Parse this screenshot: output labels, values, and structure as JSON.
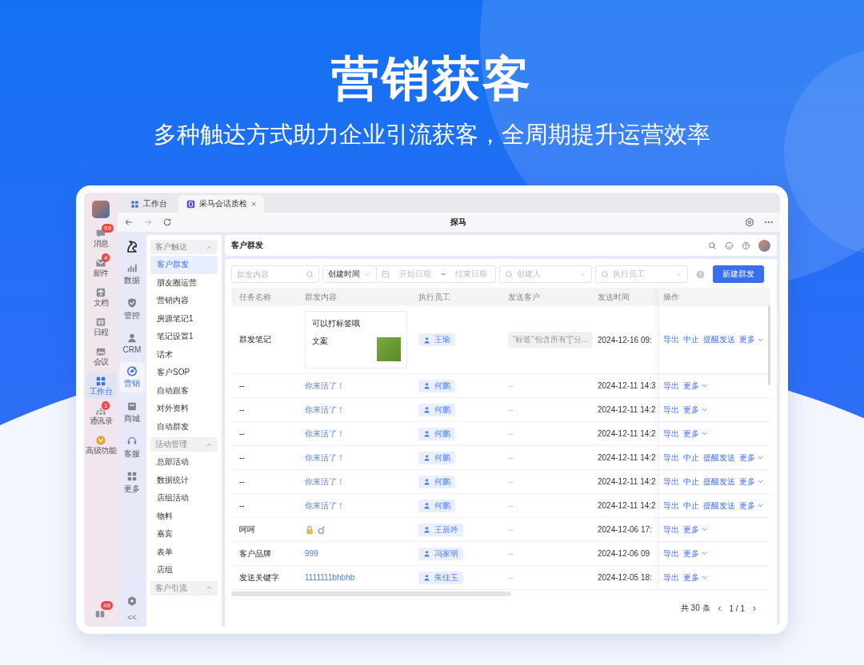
{
  "hero": {
    "title": "营销获客",
    "subtitle": "多种触达方式助力企业引流获客，全周期提升运营效率"
  },
  "app_rail": {
    "items": [
      {
        "label": "消息",
        "badge": "99",
        "selected": false
      },
      {
        "label": "邮件",
        "badge": "4",
        "selected": false
      },
      {
        "label": "文档",
        "selected": false
      },
      {
        "label": "日程",
        "selected": false
      },
      {
        "label": "会议",
        "selected": false
      },
      {
        "label": "工作台",
        "selected": true
      },
      {
        "label": "通讯录",
        "badge": "1",
        "selected": false
      },
      {
        "label": "高级功能",
        "selected": false
      }
    ],
    "footer_badge": "49"
  },
  "browser": {
    "tabs": [
      {
        "label": "工作台",
        "selected": false
      },
      {
        "label": "采马会话质检",
        "selected": true,
        "close": "×"
      }
    ],
    "title": "探马"
  },
  "module_rail": {
    "items": [
      {
        "label": "数据",
        "selected": false
      },
      {
        "label": "管控",
        "selected": false
      },
      {
        "label": "CRM",
        "selected": false
      },
      {
        "label": "营销",
        "selected": true
      },
      {
        "label": "商城",
        "selected": false
      },
      {
        "label": "客服",
        "selected": false
      },
      {
        "label": "更多",
        "selected": false
      }
    ],
    "collapse": "<<"
  },
  "sidebar": {
    "groups": [
      {
        "title": "客户触达",
        "expanded": true,
        "items": [
          {
            "label": "客户群发",
            "selected": true
          },
          {
            "label": "朋友圈运营",
            "selected": false
          },
          {
            "label": "营销内容",
            "selected": false
          },
          {
            "label": "房源笔记1",
            "selected": false
          },
          {
            "label": "笔记设置1",
            "selected": false
          },
          {
            "label": "话术",
            "selected": false
          },
          {
            "label": "客户SOP",
            "selected": false
          },
          {
            "label": "自动跟客",
            "selected": false
          },
          {
            "label": "对外资料",
            "selected": false
          },
          {
            "label": "自动群发",
            "selected": false
          }
        ]
      },
      {
        "title": "活动管理",
        "expanded": true,
        "items": [
          {
            "label": "总部活动",
            "selected": false
          },
          {
            "label": "数据统计",
            "selected": false
          },
          {
            "label": "店组活动",
            "selected": false
          },
          {
            "label": "物料",
            "selected": false
          },
          {
            "label": "嘉宾",
            "selected": false
          },
          {
            "label": "表单",
            "selected": false
          },
          {
            "label": "店组",
            "selected": false
          }
        ]
      },
      {
        "title": "客户引流",
        "expanded": true
      }
    ]
  },
  "page": {
    "title": "客户群发"
  },
  "filters": {
    "content_placeholder": "群发内容",
    "time_select": "创建时间",
    "start_placeholder": "开始日期",
    "range_separator": "~",
    "end_placeholder": "结束日期",
    "creator_placeholder": "创建人",
    "staff_placeholder": "执行员工",
    "create_button": "新建群发"
  },
  "table": {
    "columns": [
      "任务名称",
      "群发内容",
      "执行员工",
      "发送客户",
      "发送时间",
      "操作"
    ],
    "rows": [
      {
        "name": "群发笔记",
        "content": {
          "kind": "card",
          "lines": [
            "可以打标签哦",
            "文案"
          ]
        },
        "staff": "王瑜",
        "customer": {
          "kind": "tag",
          "text": "“标签”包含所有“[“分..."
        },
        "time": "2024-12-16 09:",
        "actions": [
          "导出",
          "中止",
          "提醒发送",
          "更多"
        ]
      },
      {
        "name": "--",
        "content": {
          "kind": "link",
          "text": "你来活了！"
        },
        "staff": "何鹏",
        "customer": {
          "kind": "empty",
          "text": "--"
        },
        "time": "2024-12-11 14:3",
        "actions": [
          "导出",
          "更多"
        ]
      },
      {
        "name": "--",
        "content": {
          "kind": "link",
          "text": "你来活了！"
        },
        "staff": "何鹏",
        "customer": {
          "kind": "empty",
          "text": "--"
        },
        "time": "2024-12-11 14:2",
        "actions": [
          "导出",
          "更多"
        ]
      },
      {
        "name": "--",
        "content": {
          "kind": "link",
          "text": "你来活了！"
        },
        "staff": "何鹏",
        "customer": {
          "kind": "empty",
          "text": "--"
        },
        "time": "2024-12-11 14:2",
        "actions": [
          "导出",
          "更多"
        ]
      },
      {
        "name": "--",
        "content": {
          "kind": "link",
          "text": "你来活了！"
        },
        "staff": "何鹏",
        "customer": {
          "kind": "empty",
          "text": "--"
        },
        "time": "2024-12-11 14:2",
        "actions": [
          "导出",
          "中止",
          "提醒发送",
          "更多"
        ]
      },
      {
        "name": "--",
        "content": {
          "kind": "link",
          "text": "你来活了！"
        },
        "staff": "何鹏",
        "customer": {
          "kind": "empty",
          "text": "--"
        },
        "time": "2024-12-11 14:2",
        "actions": [
          "导出",
          "中止",
          "提醒发送",
          "更多"
        ]
      },
      {
        "name": "--",
        "content": {
          "kind": "link",
          "text": "你来活了！"
        },
        "staff": "何鹏",
        "customer": {
          "kind": "empty",
          "text": "--"
        },
        "time": "2024-12-11 14:2",
        "actions": [
          "导出",
          "中止",
          "提醒发送",
          "更多"
        ]
      },
      {
        "name": "呵呵",
        "content": {
          "kind": "emoji"
        },
        "staff": "王辰吟",
        "customer": {
          "kind": "empty",
          "text": "--"
        },
        "time": "2024-12-06 17:",
        "actions": [
          "导出",
          "更多"
        ]
      },
      {
        "name": "客户品牌",
        "content": {
          "kind": "link",
          "text": "999"
        },
        "staff": "冯家明",
        "customer": {
          "kind": "empty",
          "text": "--"
        },
        "time": "2024-12-06 09",
        "actions": [
          "导出",
          "更多"
        ]
      },
      {
        "name": "发送关键字",
        "content": {
          "kind": "link",
          "text": "1111111bhbhb"
        },
        "staff": "朱佳玉",
        "customer": {
          "kind": "empty",
          "text": "--"
        },
        "time": "2024-12-05 18:",
        "actions": [
          "导出",
          "更多"
        ]
      }
    ]
  },
  "pagination": {
    "total": "共 30 条",
    "prev": "‹",
    "pages": "1 / 1",
    "next": "›"
  }
}
